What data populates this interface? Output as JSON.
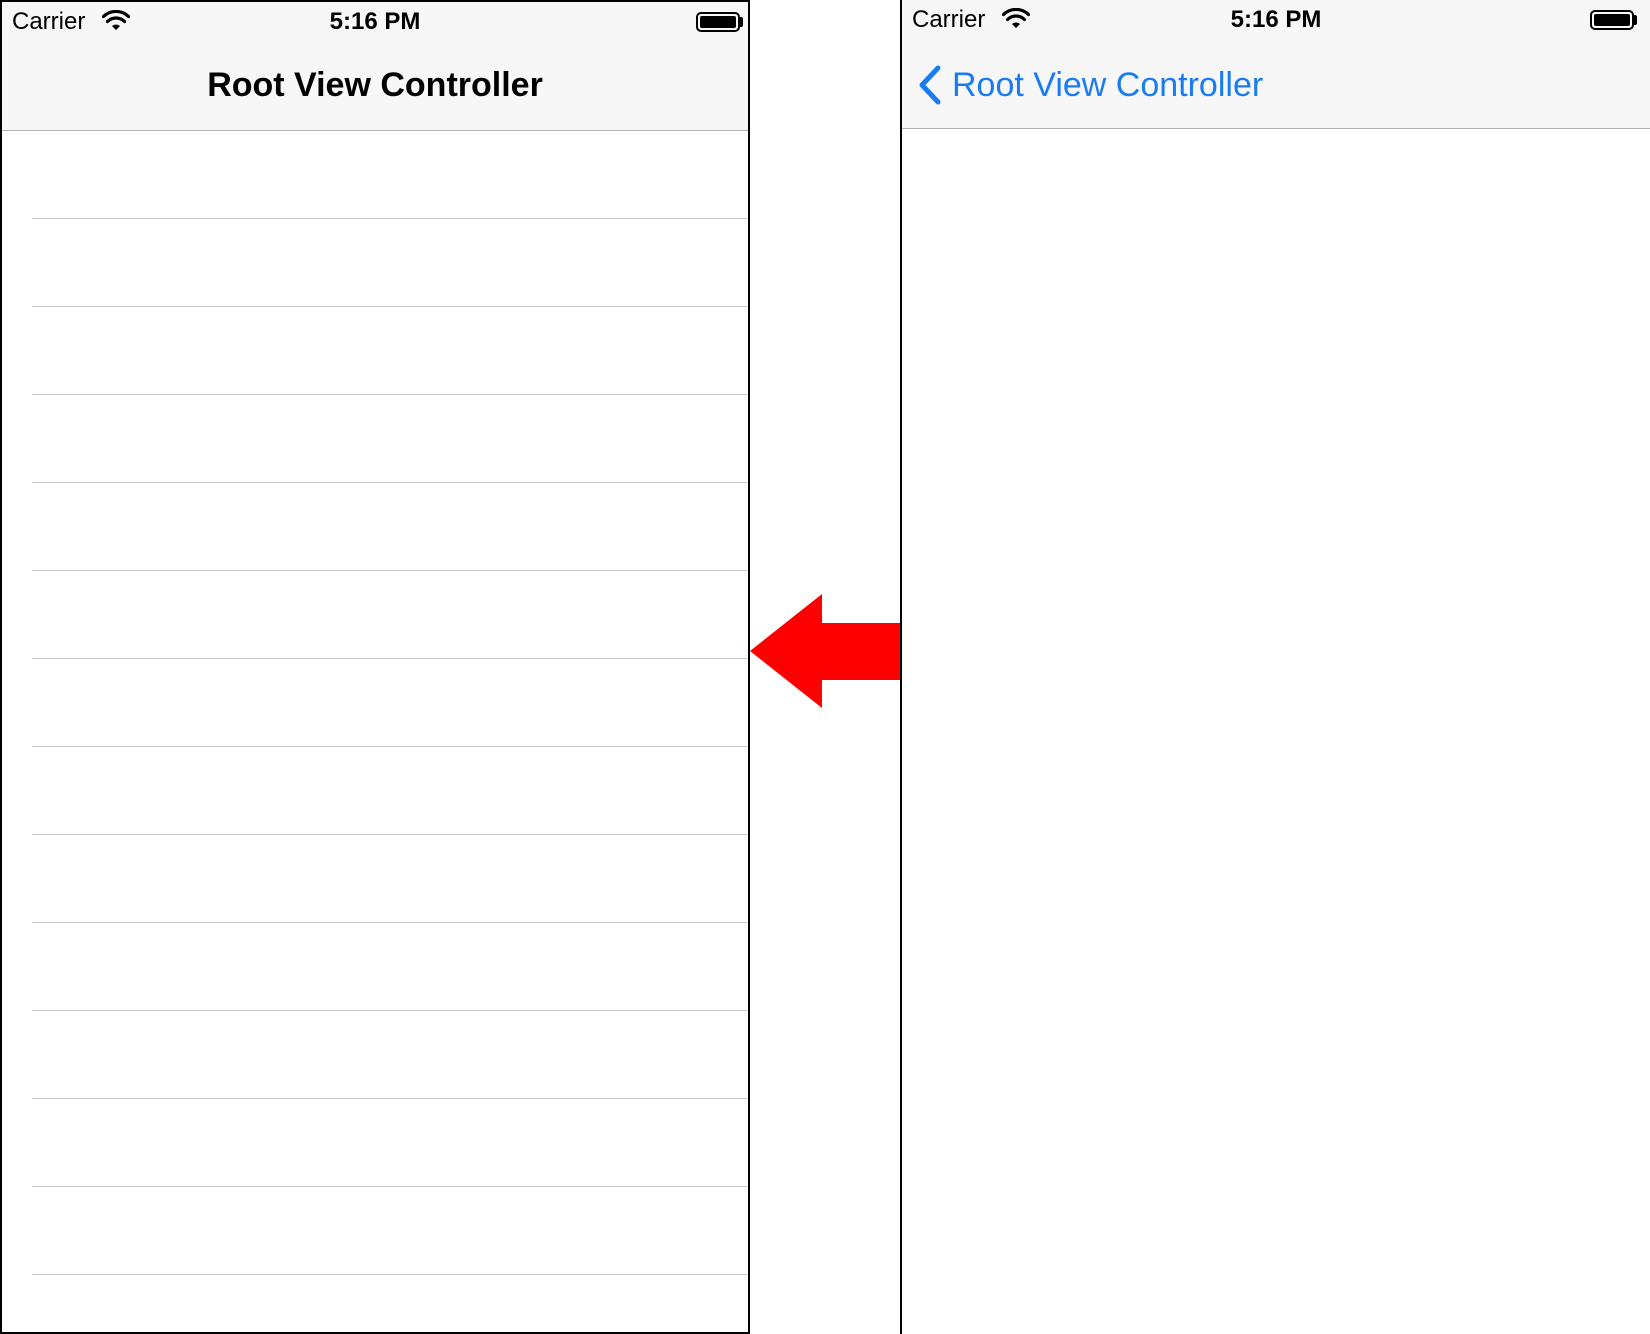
{
  "left_screen": {
    "status_bar": {
      "carrier": "Carrier",
      "time": "5:16 PM"
    },
    "nav_bar": {
      "title": "Root View Controller"
    },
    "table": {
      "row_count": 13
    }
  },
  "right_screen": {
    "status_bar": {
      "carrier": "Carrier",
      "time": "5:16 PM"
    },
    "nav_bar": {
      "back_label": "Root View Controller"
    }
  },
  "colors": {
    "accent": "#1a7cf2",
    "arrow": "#ff0000",
    "nav_background": "#f7f7f7",
    "separator": "#c8c7cc"
  },
  "icons": {
    "wifi": "wifi-icon",
    "battery": "battery-icon",
    "back": "chevron-left-icon",
    "transition": "left-arrow-icon"
  }
}
